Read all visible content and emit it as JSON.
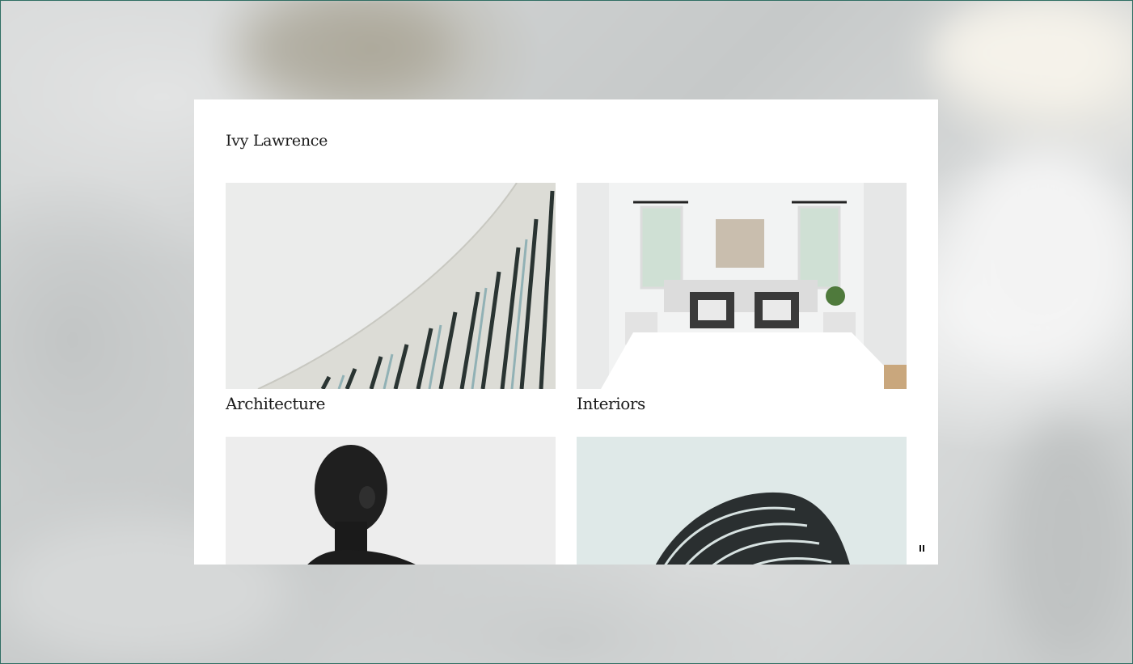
{
  "site": {
    "title": "Ivy Lawrence"
  },
  "gallery": {
    "items": [
      {
        "label": "Architecture",
        "icon": "building-facade-image"
      },
      {
        "label": "Interiors",
        "icon": "bedroom-interior-image"
      },
      {
        "label": "",
        "icon": "portrait-man-image"
      },
      {
        "label": "",
        "icon": "sculpture-image"
      }
    ]
  },
  "controls": {
    "pause_icon": "pause-icon"
  },
  "colors": {
    "card_background": "#ffffff",
    "text": "#1b1b1b",
    "frame_border": "#2f6e63"
  }
}
